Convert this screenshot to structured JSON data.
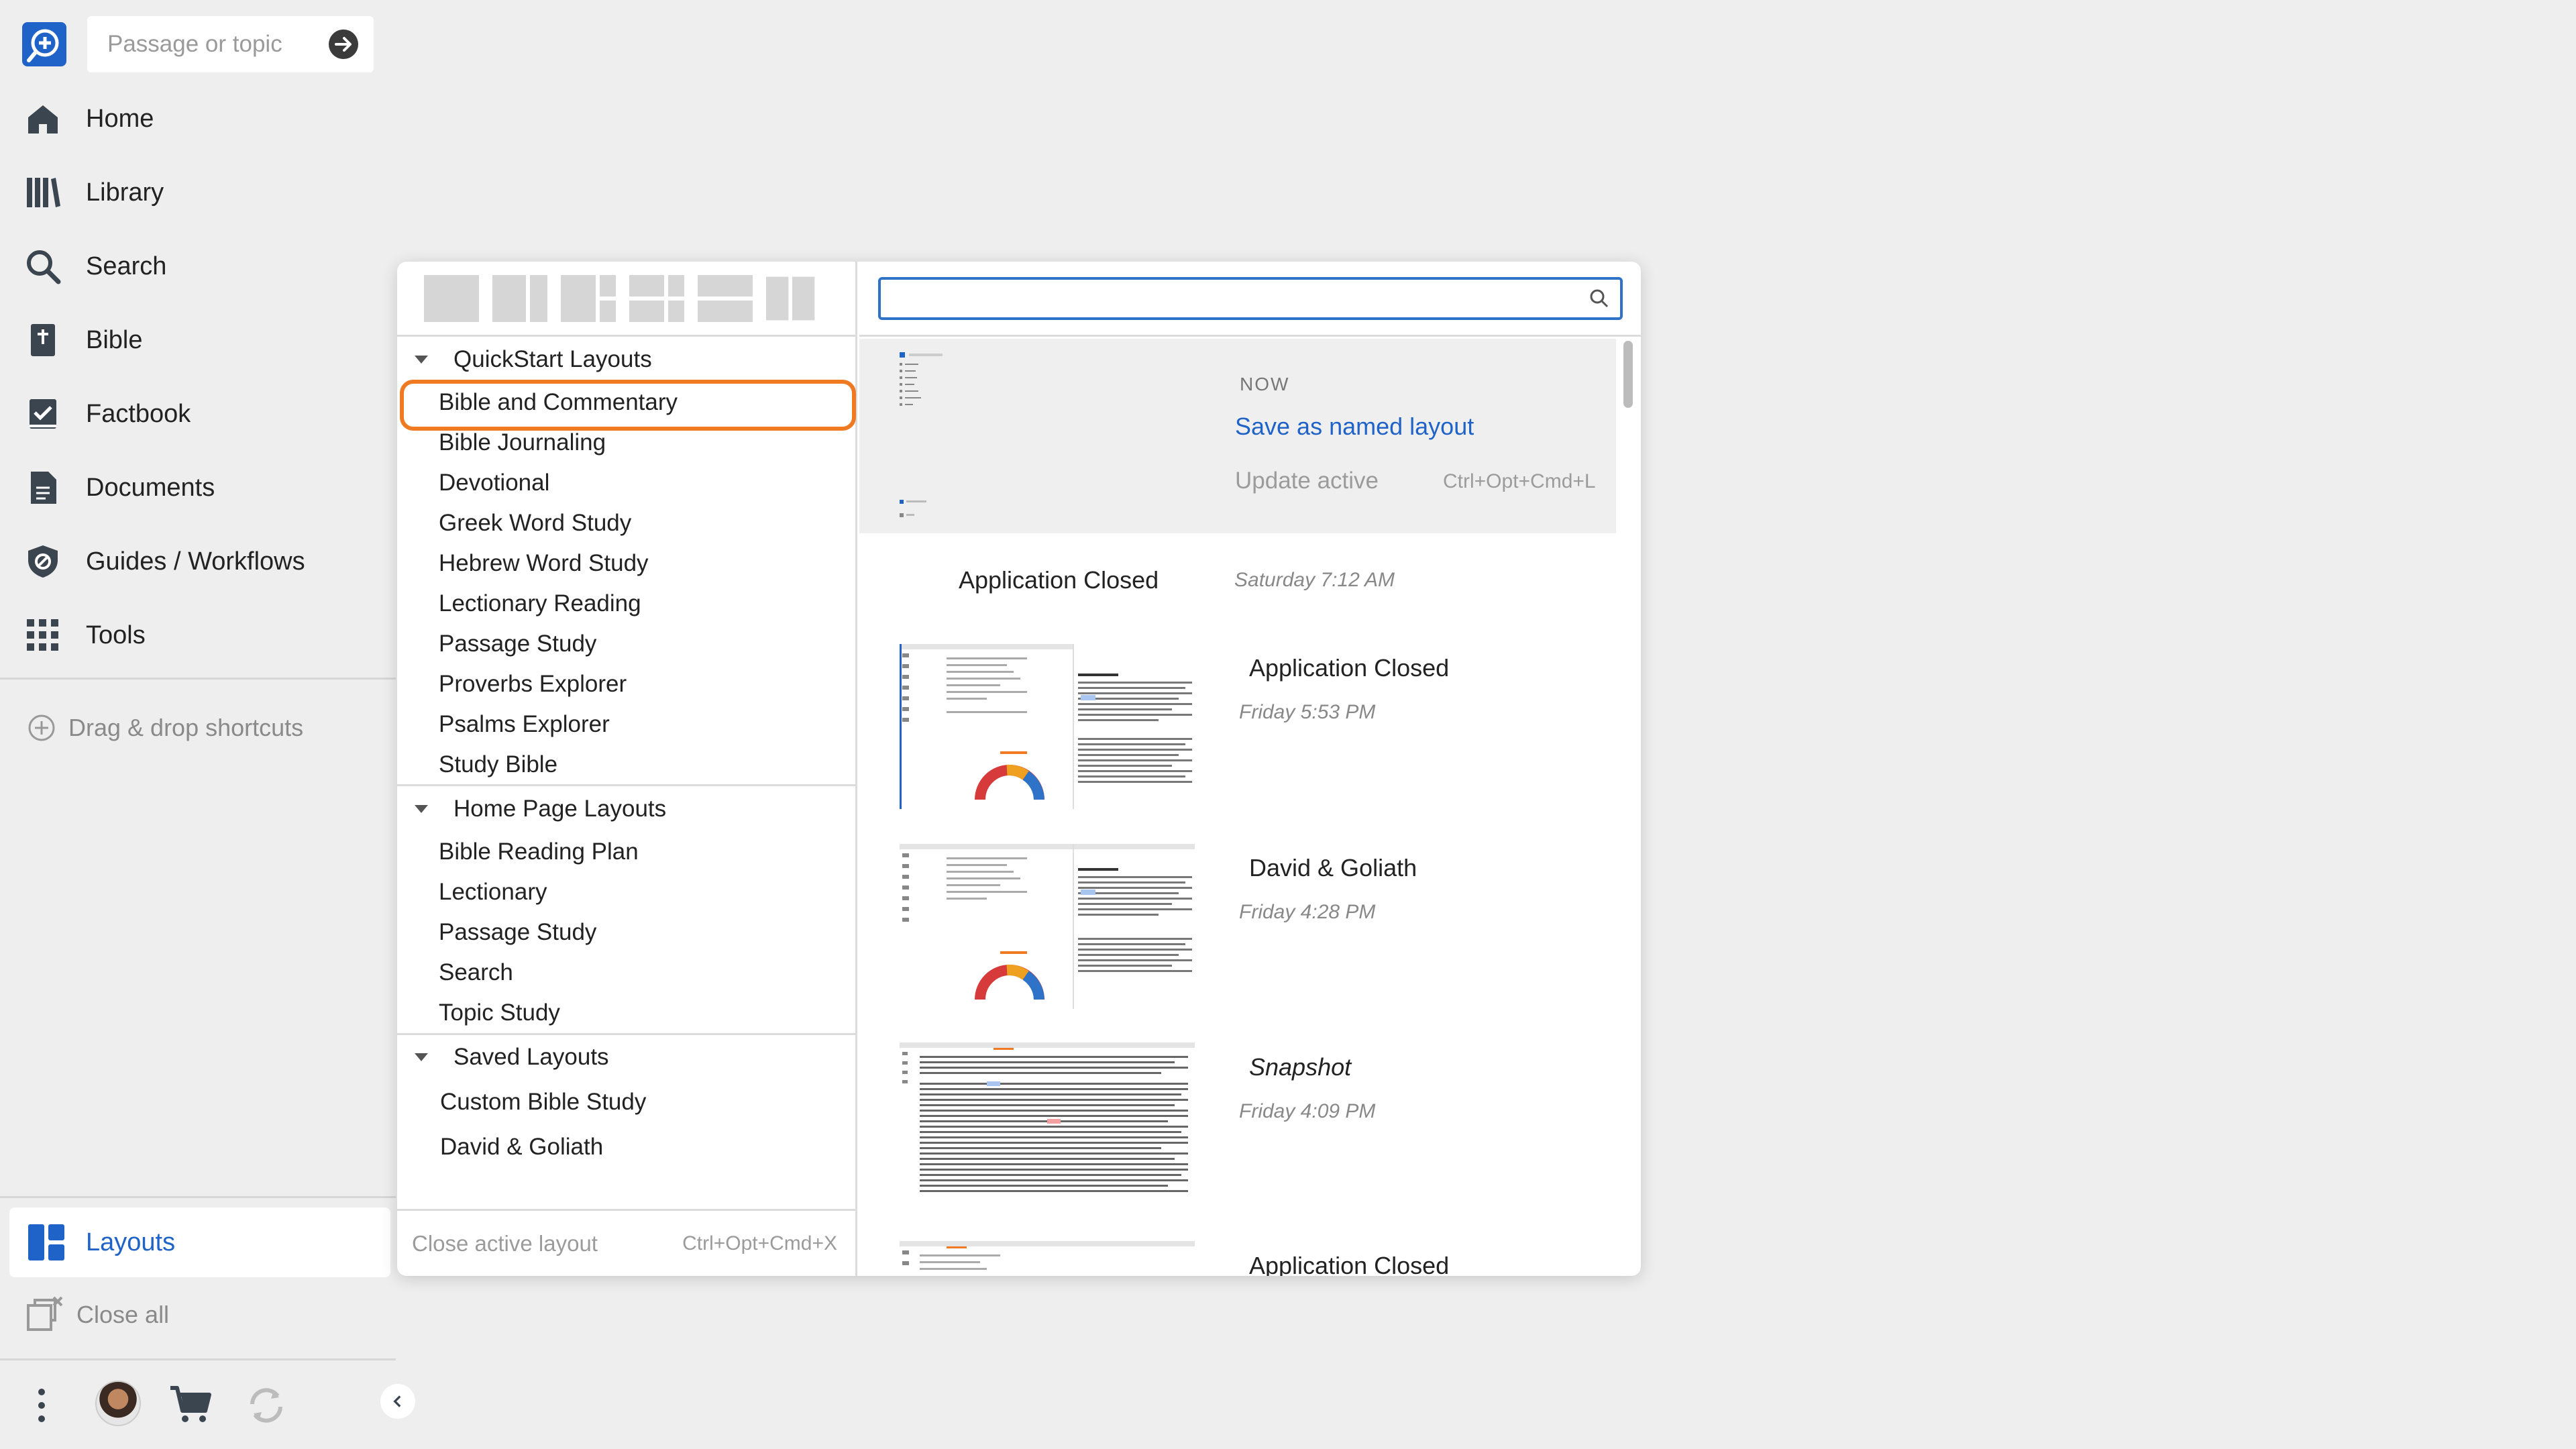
{
  "sidebar": {
    "search_placeholder": "Passage or topic",
    "nav": [
      {
        "label": "Home",
        "icon": "home-icon"
      },
      {
        "label": "Library",
        "icon": "library-icon"
      },
      {
        "label": "Search",
        "icon": "search-icon"
      },
      {
        "label": "Bible",
        "icon": "bible-icon"
      },
      {
        "label": "Factbook",
        "icon": "factbook-icon"
      },
      {
        "label": "Documents",
        "icon": "documents-icon"
      },
      {
        "label": "Guides / Workflows",
        "icon": "guides-icon"
      },
      {
        "label": "Tools",
        "icon": "tools-icon"
      }
    ],
    "drag_drop_label": "Drag & drop shortcuts",
    "layouts_label": "Layouts",
    "close_all_label": "Close all"
  },
  "layouts_panel": {
    "groups": [
      {
        "title": "QuickStart Layouts",
        "items": [
          "Bible and Commentary",
          "Bible Journaling",
          "Devotional",
          "Greek Word Study",
          "Hebrew Word Study",
          "Lectionary Reading",
          "Passage Study",
          "Proverbs Explorer",
          "Psalms Explorer",
          "Study Bible"
        ]
      },
      {
        "title": "Home Page Layouts",
        "items": [
          "Bible Reading Plan",
          "Lectionary",
          "Passage Study",
          "Search",
          "Topic Study"
        ]
      },
      {
        "title": "Saved Layouts",
        "items": [
          "Custom Bible Study",
          "David & Goliath"
        ]
      }
    ],
    "selected_item": "Bible and Commentary",
    "close_active_label": "Close active layout",
    "close_active_shortcut": "Ctrl+Opt+Cmd+X",
    "now_label": "NOW",
    "save_named_label": "Save as named layout",
    "update_active_label": "Update active",
    "update_active_shortcut": "Ctrl+Opt+Cmd+L",
    "history": [
      {
        "title": "Application Closed",
        "time": "Saturday 7:12 AM"
      },
      {
        "title": "Application Closed",
        "time": "Friday 5:53 PM"
      },
      {
        "title": "David & Goliath",
        "time": "Friday 4:28 PM"
      },
      {
        "title": "Snapshot",
        "time": "Friday 4:09 PM"
      },
      {
        "title": "Application Closed",
        "time": ""
      }
    ]
  },
  "colors": {
    "accent": "#1f63c8",
    "selection_ring": "#f07a22",
    "background": "#eeeeee"
  }
}
